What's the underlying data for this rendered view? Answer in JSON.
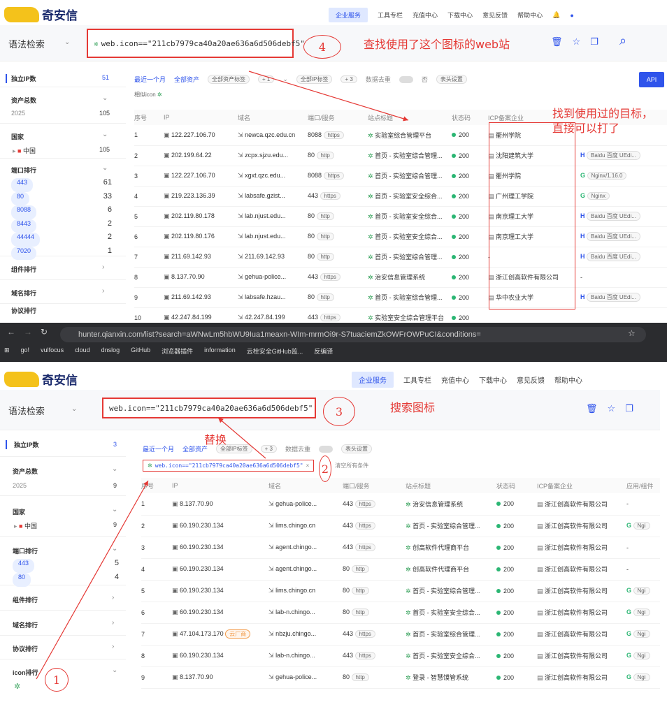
{
  "top": {
    "logo_text": "奇安信",
    "nav": [
      "企业服务",
      "工具专栏",
      "充值中心",
      "下载中心",
      "意见反馈",
      "帮助中心"
    ],
    "syntax_label": "语法检索",
    "query": "web.icon==\"211cb7979ca40a20ae636a6d506debf5\"",
    "filter_row": {
      "time": "最近一个月",
      "assets": "全部资产",
      "asset_tag": "全部资产标签",
      "plus1": "+ 1",
      "ip_tag": "全部IP标签",
      "plus3": "+ 3",
      "dedupe": "数据去重",
      "dedupe_val": "否",
      "header_settings": "表头设置",
      "api": "API"
    },
    "similar_icon_label": "相似icon",
    "columns": [
      "序号",
      "IP",
      "域名",
      "端口/服务",
      "站点标题",
      "状态码",
      "ICP备案企业"
    ],
    "rows": [
      {
        "n": "1",
        "ip": "122.227.106.70",
        "domain": "newca.qzc.edu.cn",
        "port": "8088",
        "svc": "https",
        "title": "实验室综合管理平台",
        "code": "200",
        "icp": "衢州学院",
        "extra": ""
      },
      {
        "n": "2",
        "ip": "202.199.64.22",
        "domain": "zcpx.sjzu.edu...",
        "port": "80",
        "svc": "http",
        "title": "首页 - 实验室综合管理...",
        "code": "200",
        "icp": "沈阳建筑大学",
        "extra": "Baidu 百度 UEdi..."
      },
      {
        "n": "3",
        "ip": "122.227.106.70",
        "domain": "xgxt.qzc.edu...",
        "port": "8088",
        "svc": "https",
        "title": "首页 - 实验室综合管理...",
        "code": "200",
        "icp": "衢州学院",
        "extra": "Nginx/1.16.0"
      },
      {
        "n": "4",
        "ip": "219.223.136.39",
        "domain": "labsafe.gzist...",
        "port": "443",
        "svc": "https",
        "title": "首页 - 实验室安全综合...",
        "code": "200",
        "icp": "广州理工学院",
        "extra": "Nginx"
      },
      {
        "n": "5",
        "ip": "202.119.80.178",
        "domain": "lab.njust.edu...",
        "port": "80",
        "svc": "http",
        "title": "首页 - 实验室安全综合...",
        "code": "200",
        "icp": "南京理工大学",
        "extra": "Baidu 百度 UEdi..."
      },
      {
        "n": "6",
        "ip": "202.119.80.176",
        "domain": "lab.njust.edu...",
        "port": "80",
        "svc": "http",
        "title": "首页 - 实验室安全综合...",
        "code": "200",
        "icp": "南京理工大学",
        "extra": "Baidu 百度 UEdi..."
      },
      {
        "n": "7",
        "ip": "211.69.142.93",
        "domain": "211.69.142.93",
        "port": "80",
        "svc": "http",
        "title": "首页 - 实验室综合管理...",
        "code": "200",
        "icp": "-",
        "extra": "Baidu 百度 UEdi..."
      },
      {
        "n": "8",
        "ip": "8.137.70.90",
        "domain": "gehua-police...",
        "port": "443",
        "svc": "https",
        "title": "治安信息管理系统",
        "code": "200",
        "icp": "浙江创高软件有限公司",
        "extra": "-"
      },
      {
        "n": "9",
        "ip": "211.69.142.93",
        "domain": "labsafe.hzau...",
        "port": "80",
        "svc": "http",
        "title": "首页 - 实验室综合管理...",
        "code": "200",
        "icp": "华中农业大学",
        "extra": "Baidu 百度 UEdi..."
      },
      {
        "n": "10",
        "ip": "42.247.84.199",
        "domain": "42.247.84.199",
        "port": "443",
        "svc": "https",
        "title": "实验室安全综合管理平台",
        "code": "200",
        "icp": "",
        "extra": ""
      }
    ],
    "side": {
      "unique_ip": "独立IP数",
      "unique_ip_val": "51",
      "asset_total": "资产总数",
      "year": "2025",
      "year_val": "105",
      "country": "国家",
      "china": "中国",
      "china_val": "105",
      "port_rank": "端口排行",
      "ports": [
        [
          "443",
          "61"
        ],
        [
          "80",
          "33"
        ],
        [
          "8088",
          "6"
        ],
        [
          "8443",
          "2"
        ],
        [
          "44444",
          "2"
        ],
        [
          "7020",
          "1"
        ]
      ],
      "comp_rank": "组件排行",
      "domain_rank": "域名排行",
      "proto_rank": "协议排行"
    },
    "annotations": {
      "a4": "查找使用了这个图标的web站",
      "a_found": "找到使用过的目标，\n直接可以打了",
      "circ4": "4"
    }
  },
  "browser": {
    "url": "hunter.qianxin.com/list?search=aWNwLm5hbWU9Iua1meaxn-WIm-mrmOi9r-S7tuaciemZkOWFrOWPuCI&conditions=",
    "bookmarks": [
      "go!",
      "vulfocus",
      "cloud",
      "dnslog",
      "GitHub",
      "浏览器插件",
      "information",
      "云栓安全GitHub监...",
      "反编译"
    ]
  },
  "bottom": {
    "logo_text": "奇安信",
    "nav": [
      "企业服务",
      "工具专栏",
      "充值中心",
      "下载中心",
      "意见反馈",
      "帮助中心"
    ],
    "syntax_label": "语法检索",
    "query": "web.icon==\"211cb7979ca40a20ae636a6d506debf5\"",
    "filter_row": {
      "time": "最近一个月",
      "assets": "全部资产",
      "ip_tag": "全部IP标签",
      "plus3": "+ 3",
      "dedupe": "数据去重",
      "header_settings": "表头设置",
      "clear": "清空所有条件"
    },
    "chip": "web.icon==\"211cb7979ca40a20ae636a6d506debf5\"",
    "columns": [
      "序号",
      "IP",
      "域名",
      "端口/服务",
      "站点标题",
      "状态码",
      "ICP备案企业",
      "应用/组件"
    ],
    "rows": [
      {
        "n": "1",
        "ip": "8.137.70.90",
        "domain": "gehua-police...",
        "port": "443",
        "svc": "https",
        "title": "治安信息管理系统",
        "code": "200",
        "icp": "浙江创高软件有限公司",
        "extra": "-"
      },
      {
        "n": "2",
        "ip": "60.190.230.134",
        "domain": "lims.chingo.cn",
        "port": "443",
        "svc": "https",
        "title": "首页 - 实验室综合管理...",
        "code": "200",
        "icp": "浙江创高软件有限公司",
        "extra": "Ngi"
      },
      {
        "n": "3",
        "ip": "60.190.230.134",
        "domain": "agent.chingo...",
        "port": "443",
        "svc": "https",
        "title": "创高软件代理商平台",
        "code": "200",
        "icp": "浙江创高软件有限公司",
        "extra": "-"
      },
      {
        "n": "4",
        "ip": "60.190.230.134",
        "domain": "agent.chingo...",
        "port": "80",
        "svc": "http",
        "title": "创高软件代理商平台",
        "code": "200",
        "icp": "浙江创高软件有限公司",
        "extra": "-"
      },
      {
        "n": "5",
        "ip": "60.190.230.134",
        "domain": "lims.chingo.cn",
        "port": "80",
        "svc": "http",
        "title": "首页 - 实验室综合管理...",
        "code": "200",
        "icp": "浙江创高软件有限公司",
        "extra": "Ngi"
      },
      {
        "n": "6",
        "ip": "60.190.230.134",
        "domain": "lab-n.chingo...",
        "port": "80",
        "svc": "http",
        "title": "首页 - 实验室安全综合...",
        "code": "200",
        "icp": "浙江创高软件有限公司",
        "extra": "Ngi"
      },
      {
        "n": "7",
        "ip": "47.104.173.170",
        "domain": "nbzju.chingo...",
        "port": "443",
        "svc": "https",
        "title": "首页 - 实验室综合管理...",
        "code": "200",
        "icp": "浙江创高软件有限公司",
        "extra": "Ngi",
        "cloud": "云厂商"
      },
      {
        "n": "8",
        "ip": "60.190.230.134",
        "domain": "lab-n.chingo...",
        "port": "443",
        "svc": "https",
        "title": "首页 - 实验室安全综合...",
        "code": "200",
        "icp": "浙江创高软件有限公司",
        "extra": "Ngi"
      },
      {
        "n": "9",
        "ip": "8.137.70.90",
        "domain": "gehua-police...",
        "port": "80",
        "svc": "http",
        "title": "登录 - 智慧馍管系统",
        "code": "200",
        "icp": "浙江创高软件有限公司",
        "extra": "Ngi"
      }
    ],
    "side": {
      "unique_ip": "独立IP数",
      "unique_ip_val": "3",
      "asset_total": "资产总数",
      "year": "2025",
      "year_val": "9",
      "country": "国家",
      "china": "中国",
      "china_val": "9",
      "port_rank": "端口排行",
      "ports": [
        [
          "443",
          "5"
        ],
        [
          "80",
          "4"
        ]
      ],
      "comp_rank": "组件排行",
      "domain_rank": "域名排行",
      "proto_rank": "协议排行",
      "icon_rank": "icon排行"
    },
    "annotations": {
      "replace": "替换",
      "search_icon": "搜索图标",
      "c1": "1",
      "c2": "2",
      "c3": "3"
    }
  },
  "colors": {
    "accent": "#2f54eb",
    "annot": "#e53935",
    "ok": "#2bb673"
  }
}
